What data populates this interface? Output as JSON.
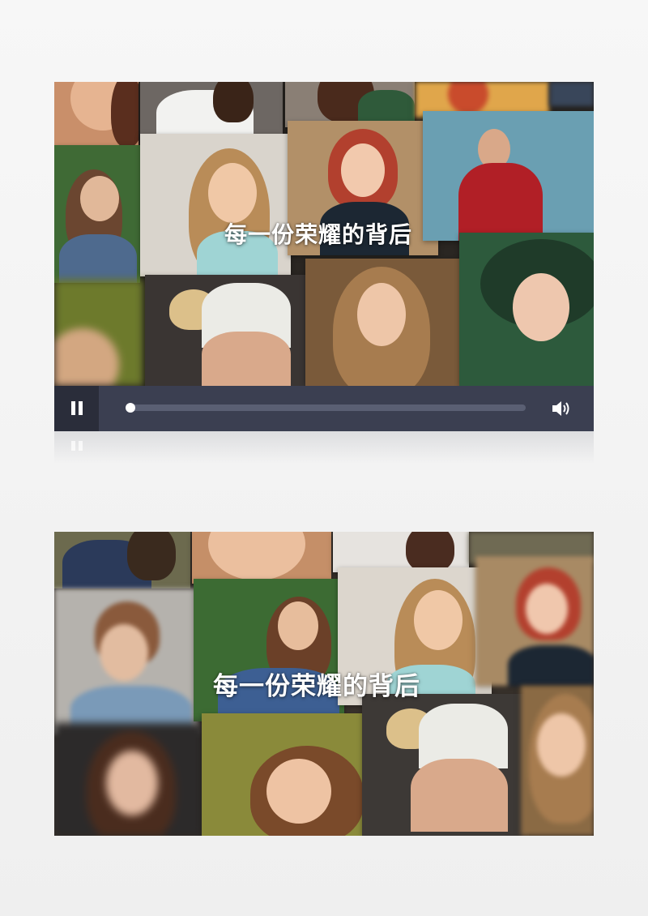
{
  "players": [
    {
      "caption": "每一份荣耀的背后",
      "controls": {
        "state": "paused",
        "progress": 0.0,
        "play_pause_icon": "pause-icon",
        "volume_icon": "volume-icon"
      }
    },
    {
      "caption": "每一份荣耀的背后"
    }
  ],
  "colors": {
    "control_bar": "#3b3f51",
    "play_button_bg": "#2a2d3a",
    "progress_track": "#5a5f73",
    "progress_fill": "#ffffff"
  }
}
